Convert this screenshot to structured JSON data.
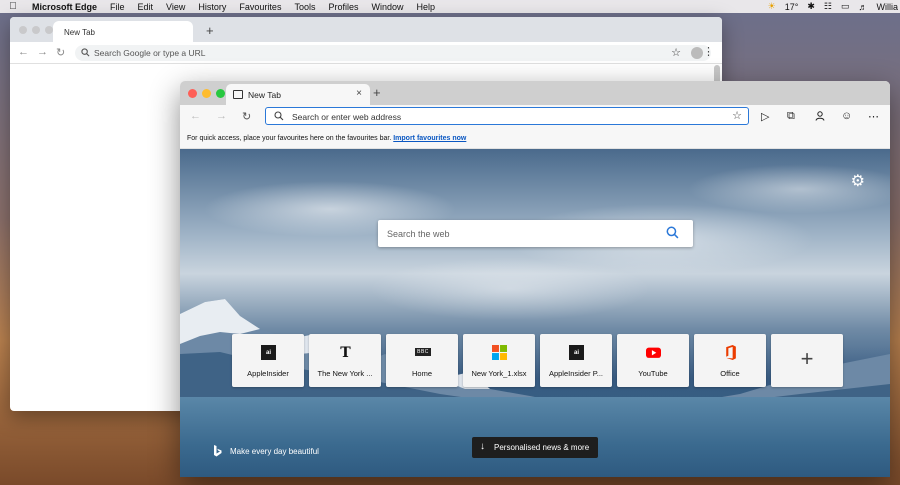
{
  "menubar": {
    "app_name": "Microsoft Edge",
    "items": [
      "File",
      "Edit",
      "View",
      "History",
      "Favourites",
      "Tools",
      "Profiles",
      "Window",
      "Help"
    ],
    "weather": "17°",
    "user": "Willia"
  },
  "chrome": {
    "tab_title": "New Tab",
    "new_tab": "+",
    "omnibox_placeholder": "Search Google or type a URL"
  },
  "edge": {
    "tab_title": "New Tab",
    "tab_close": "×",
    "new_tab": "+",
    "address_placeholder": "Search or enter web address",
    "favbar_text": "For quick access, place your favourites here on the favourites bar.",
    "favbar_link": "Import favourites now",
    "ntp": {
      "search_placeholder": "Search the web",
      "tiles": [
        {
          "label": "AppleInsider",
          "icon": "appleinsider-icon"
        },
        {
          "label": "The New York ...",
          "icon": "nyt-icon"
        },
        {
          "label": "Home",
          "icon": "bbc-icon"
        },
        {
          "label": "New York_1.xlsx",
          "icon": "microsoft-icon"
        },
        {
          "label": "AppleInsider P...",
          "icon": "appleinsider-icon"
        },
        {
          "label": "YouTube",
          "icon": "youtube-icon"
        },
        {
          "label": "Office",
          "icon": "office-icon"
        }
      ],
      "add_tile": "+",
      "bing_caption": "Make every day beautiful",
      "news_button": "Personalised news & more"
    }
  },
  "colors": {
    "edge_accent": "#2b78d8",
    "youtube_red": "#ff0000",
    "office_red": "#eb3c00"
  }
}
